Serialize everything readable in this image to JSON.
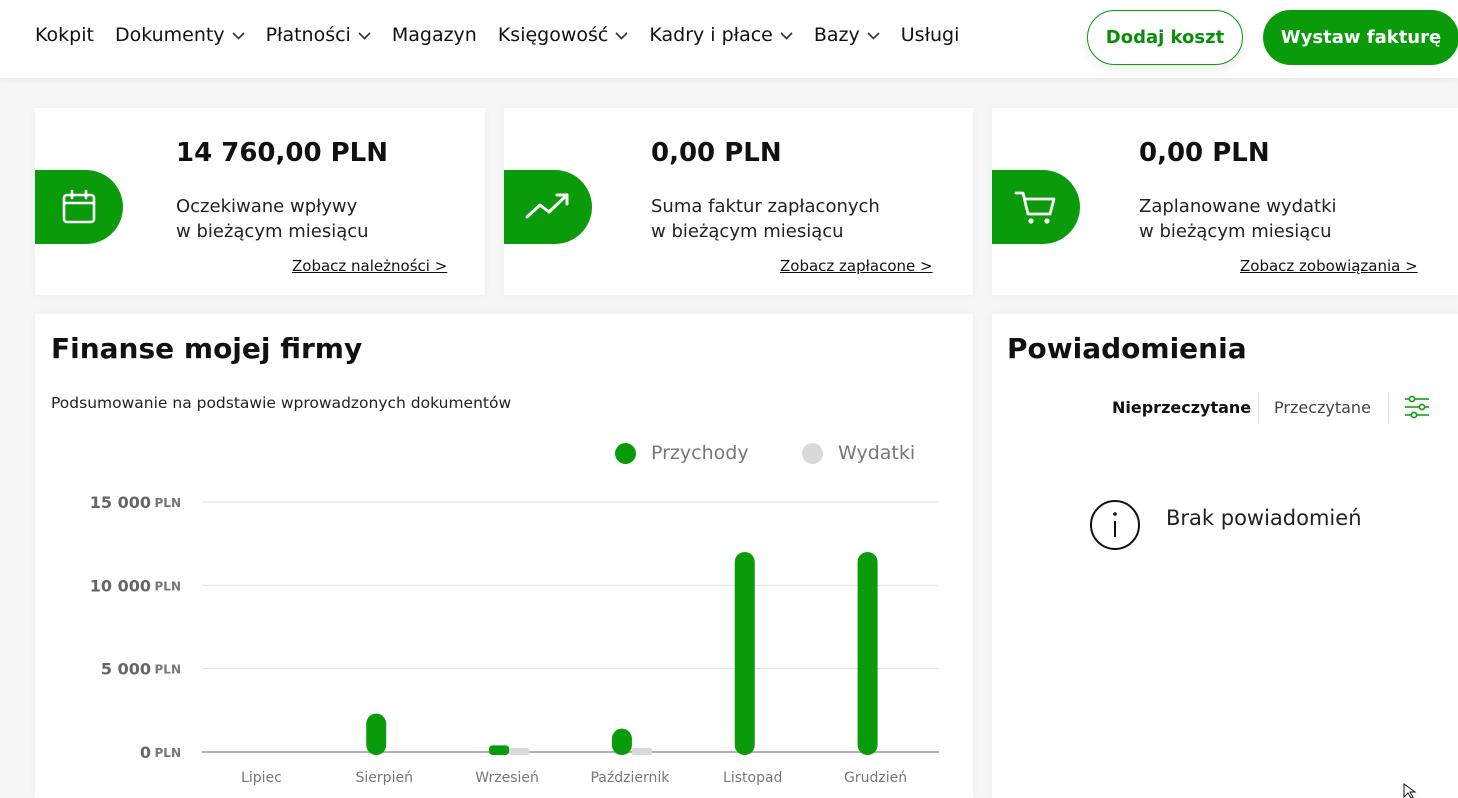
{
  "nav": {
    "items": [
      {
        "label": "Kokpit",
        "dropdown": false
      },
      {
        "label": "Dokumenty",
        "dropdown": true
      },
      {
        "label": "Płatności",
        "dropdown": true
      },
      {
        "label": "Magazyn",
        "dropdown": false
      },
      {
        "label": "Księgowość",
        "dropdown": true
      },
      {
        "label": "Kadry i płace",
        "dropdown": true
      },
      {
        "label": "Bazy",
        "dropdown": true
      },
      {
        "label": "Usługi",
        "dropdown": false
      }
    ],
    "add_cost_label": "Dodaj koszt",
    "issue_invoice_label": "Wystaw fakturę"
  },
  "stats": [
    {
      "amount": "14 760,00 PLN",
      "line1": "Oczekiwane wpływy",
      "line2": "w bieżącym miesiącu",
      "link": "Zobacz należności >",
      "icon": "calendar-icon"
    },
    {
      "amount": "0,00 PLN",
      "line1": "Suma faktur zapłaconych",
      "line2": "w bieżącym miesiącu",
      "link": "Zobacz zapłacone >",
      "icon": "trend-up-icon"
    },
    {
      "amount": "0,00 PLN",
      "line1": "Zaplanowane wydatki",
      "line2": "w bieżącym miesiącu",
      "link": "Zobacz zobowiązania >",
      "icon": "cart-icon"
    }
  ],
  "finance": {
    "title": "Finanse mojej firmy",
    "subtitle": "Podsumowanie na podstawie wprowadzonych dokumentów"
  },
  "notifications": {
    "title": "Powiadomienia",
    "tab_unread": "Nieprzeczytane",
    "tab_read": "Przeczytane",
    "empty_text": "Brak powiadomień"
  },
  "colors": {
    "accent": "#0a9b0a",
    "expense": "#d9d9d9"
  },
  "chart_data": {
    "type": "bar",
    "categories": [
      "Lipiec",
      "Sierpień",
      "Wrzesień",
      "Październik",
      "Listopad",
      "Grudzień"
    ],
    "series": [
      {
        "name": "Przychody",
        "color": "#0a9b0a",
        "values": [
          0,
          2300,
          400,
          1400,
          12000,
          12000
        ]
      },
      {
        "name": "Wydatki",
        "color": "#d9d9d9",
        "values": [
          0,
          0,
          200,
          100,
          0,
          0
        ]
      }
    ],
    "yticks": [
      {
        "value": 0,
        "num": "0",
        "unit": "PLN"
      },
      {
        "value": 5000,
        "num": "5 000",
        "unit": "PLN"
      },
      {
        "value": 10000,
        "num": "10 000",
        "unit": "PLN"
      },
      {
        "value": 15000,
        "num": "15 000",
        "unit": "PLN"
      }
    ],
    "ylim": [
      0,
      15000
    ],
    "grid": true,
    "legend": "top-right"
  }
}
